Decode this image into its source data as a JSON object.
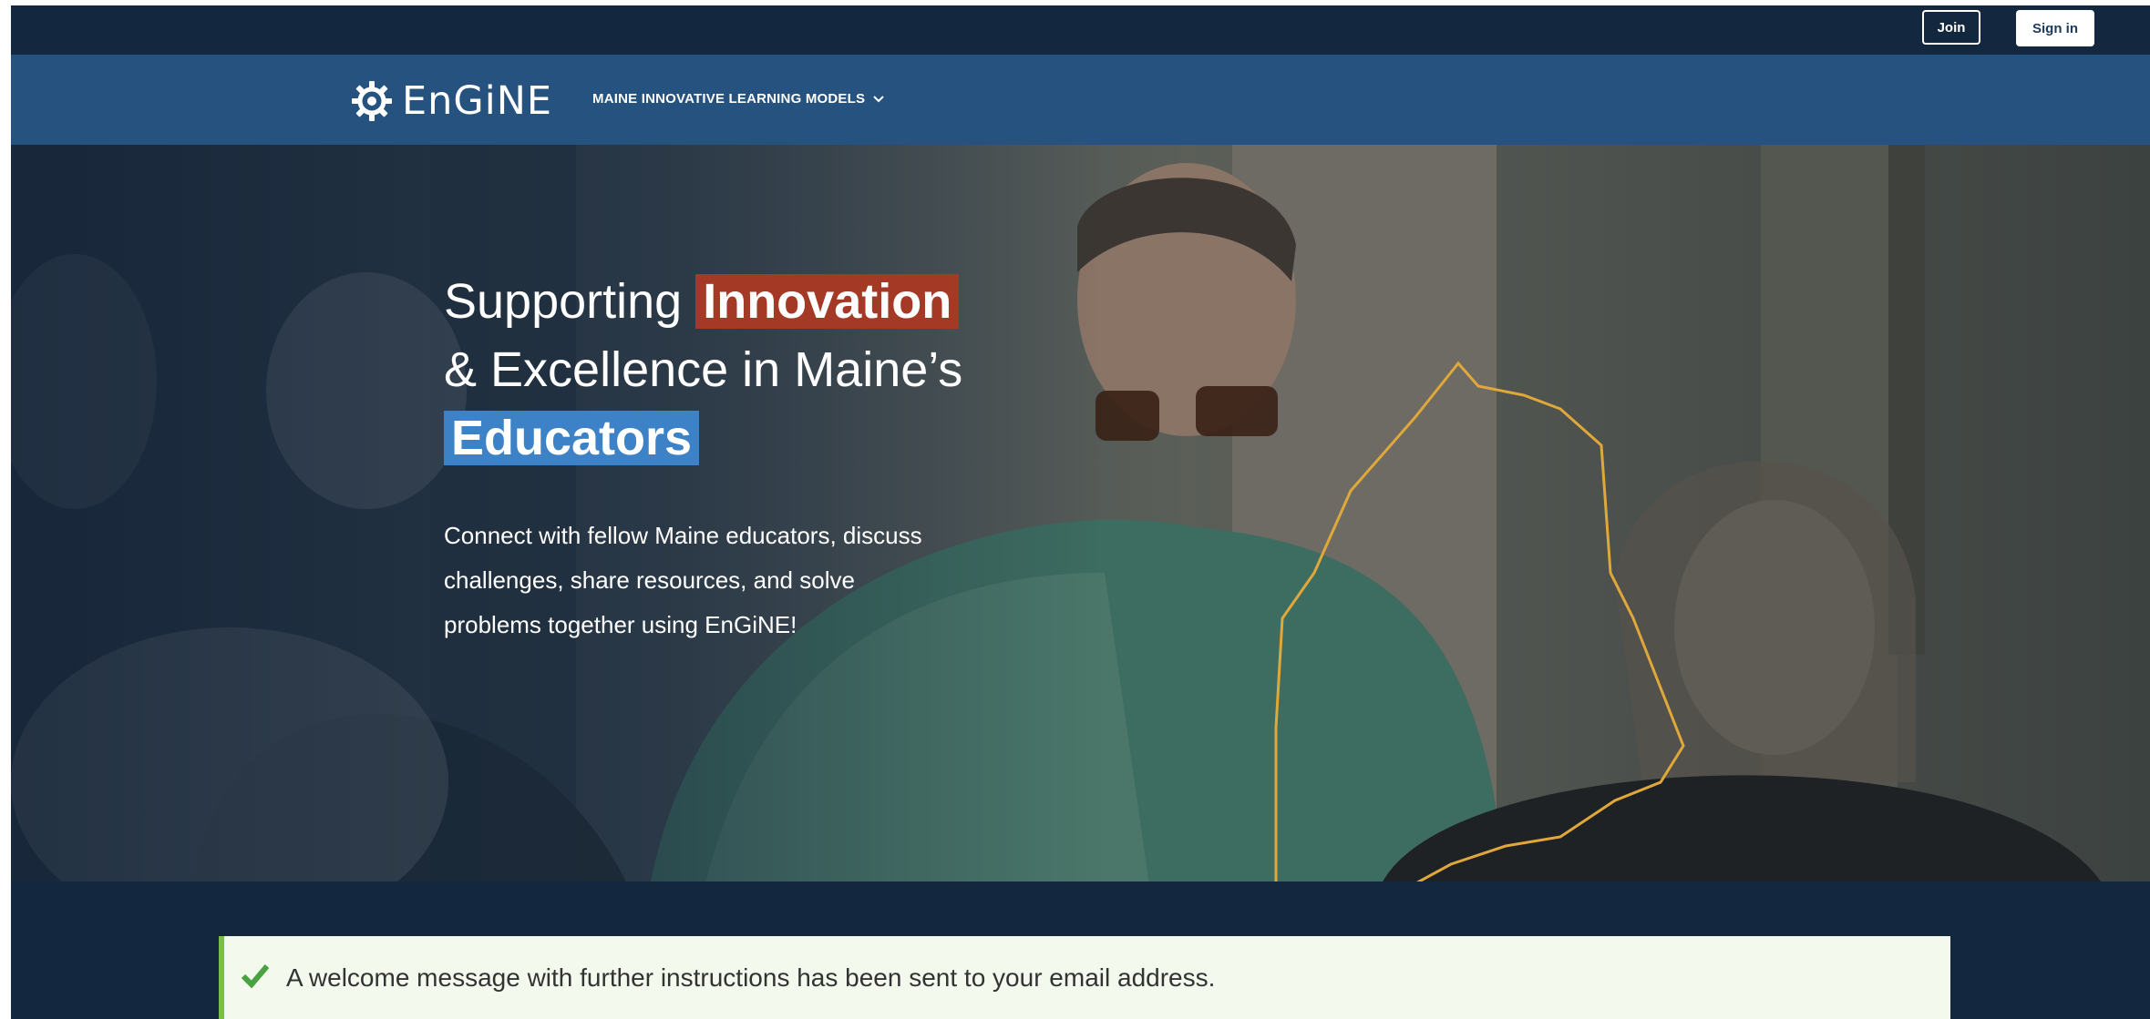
{
  "topbar": {
    "join_label": "Join",
    "signin_label": "Sign in"
  },
  "nav": {
    "logo_text": "EnGiNE",
    "logo_icon": "gear-icon",
    "menu_label": "MAINE INNOVATIVE LEARNING MODELS",
    "menu_icon": "chevron-down-icon"
  },
  "hero": {
    "headline": {
      "part1": "Supporting ",
      "highlight_red": "Innovation",
      "part2": "& Excellence in Maine’s",
      "highlight_blue": "Educators"
    },
    "description": "Connect with fellow Maine educators, discuss challenges, share resources, and solve problems together using EnGiNE!"
  },
  "status": {
    "icon": "checkmark-icon",
    "message": "A welcome message with further instructions has been sent to your email address."
  },
  "colors": {
    "topbar_bg": "#13283f",
    "nav_bg": "#25527f",
    "highlight_red": "#a43a25",
    "highlight_blue": "#3d82c6",
    "status_bg": "#f3f9ec",
    "status_accent": "#7bbd4a",
    "maine_outline": "#e0a83a"
  }
}
